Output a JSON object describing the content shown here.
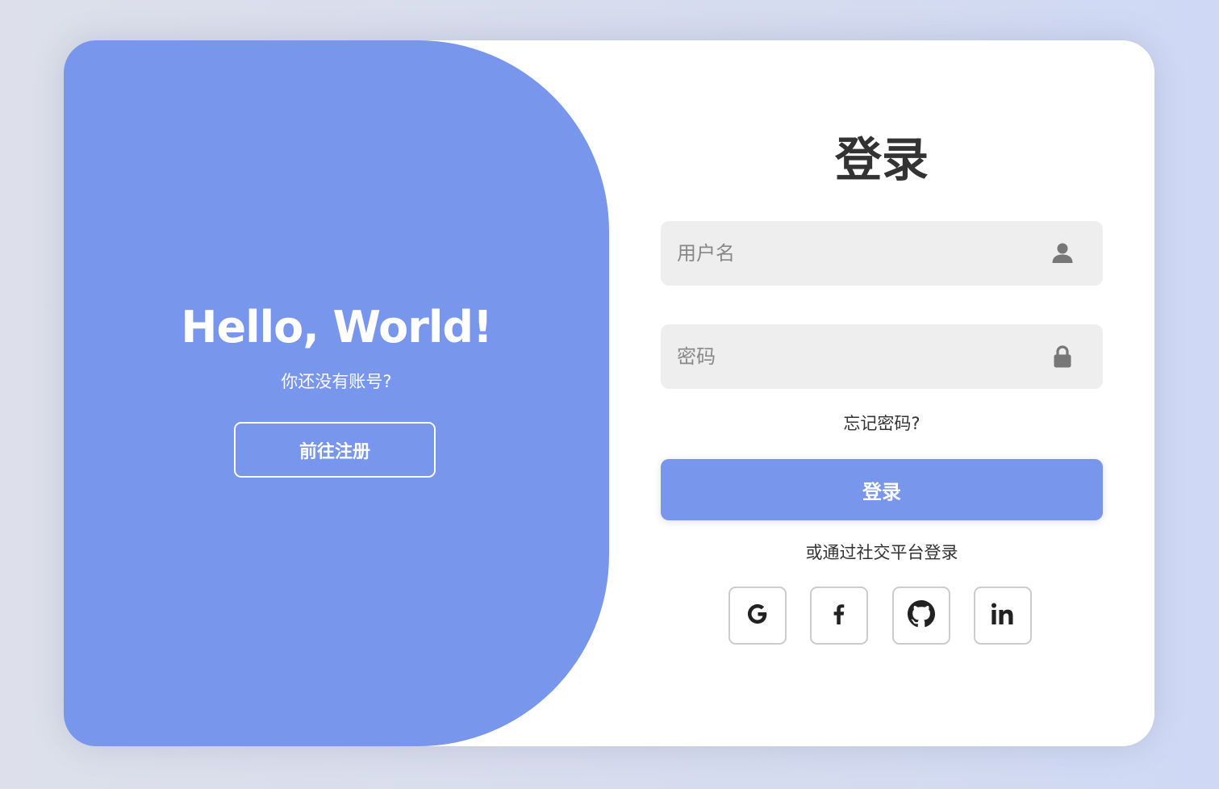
{
  "welcome": {
    "title": "Hello, World!",
    "subtitle": "你还没有账号?",
    "register_label": "前往注册"
  },
  "login": {
    "title": "登录",
    "username_placeholder": "用户名",
    "password_placeholder": "密码",
    "forgot_label": "忘记密码?",
    "submit_label": "登录",
    "social_text": "或通过社交平台登录",
    "social": [
      {
        "name": "google",
        "icon": "google-icon",
        "glyph": "G"
      },
      {
        "name": "facebook",
        "icon": "facebook-icon",
        "glyph": "f"
      },
      {
        "name": "github",
        "icon": "github-icon",
        "glyph": ""
      },
      {
        "name": "linkedin",
        "icon": "linkedin-icon",
        "glyph": "in"
      }
    ]
  },
  "colors": {
    "accent": "#7796ec",
    "text": "#333333",
    "field_bg": "#eeeeee",
    "icon_gray": "#777777"
  }
}
